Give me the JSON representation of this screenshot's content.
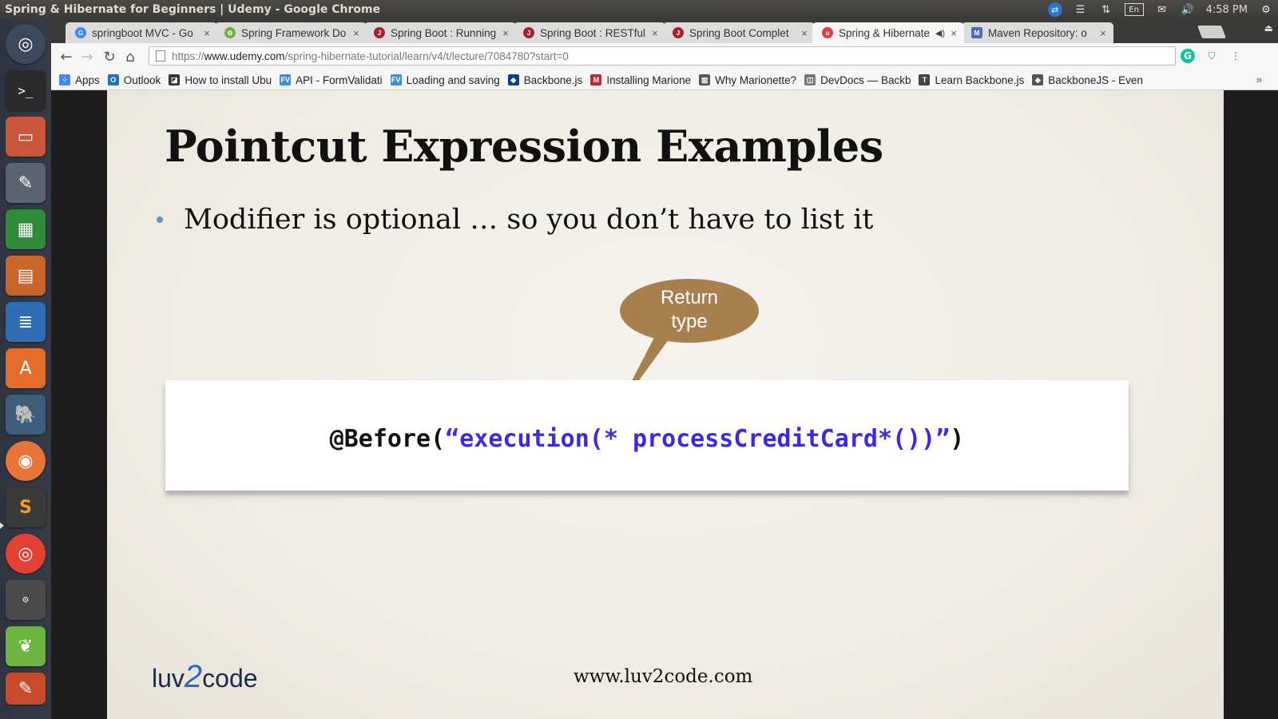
{
  "window_title": "Spring & Hibernate for Beginners | Udemy - Google Chrome",
  "system_tray": {
    "keyboard_layout": "En",
    "time": "4:58 PM"
  },
  "tabs": [
    {
      "label": "springboot MVC - Go",
      "favicon": "google-icon",
      "color": "#4285f4",
      "active": false
    },
    {
      "label": "Spring Framework Do",
      "favicon": "spring-icon",
      "color": "#6db33f",
      "active": false
    },
    {
      "label": "Spring Boot : Running",
      "favicon": "java-icon",
      "color": "#a3242c",
      "active": false
    },
    {
      "label": "Spring Boot : RESTful",
      "favicon": "java-icon",
      "color": "#a3242c",
      "active": false
    },
    {
      "label": "Spring Boot Complet",
      "favicon": "java-icon",
      "color": "#a3242c",
      "active": false
    },
    {
      "label": "Spring & Hibernate",
      "favicon": "udemy-icon",
      "color": "#e53a40",
      "active": true
    },
    {
      "label": "Maven Repository: o",
      "favicon": "maven-icon",
      "color": "#4a6fb5",
      "active": false
    }
  ],
  "address_bar": {
    "scheme": "https://",
    "host": "www.udemy.com",
    "path": "/spring-hibernate-tutorial/learn/v4/t/lecture/7084780?start=0"
  },
  "bookmarks": [
    {
      "label": "Apps",
      "icon": "apps-grid-icon",
      "color": "#4285f4"
    },
    {
      "label": "Outlook",
      "icon": "outlook-icon",
      "color": "#1f6fc5"
    },
    {
      "label": "How to install Ubu",
      "icon": "terminal-icon",
      "color": "#333"
    },
    {
      "label": "API - FormValidati",
      "icon": "fv-icon",
      "color": "#3a8ed8"
    },
    {
      "label": "Loading and saving",
      "icon": "fv-icon",
      "color": "#3a8ed8"
    },
    {
      "label": "Backbone.js",
      "icon": "backbone-icon",
      "color": "#0d3e8c"
    },
    {
      "label": "Installing Marione",
      "icon": "marionette-icon",
      "color": "#c0282d"
    },
    {
      "label": "Why Marionette?",
      "icon": "book-icon",
      "color": "#555"
    },
    {
      "label": "DevDocs — Backb",
      "icon": "devdocs-icon",
      "color": "#777"
    },
    {
      "label": "Learn Backbone.js",
      "icon": "text-icon",
      "color": "#444"
    },
    {
      "label": "BackboneJS - Even",
      "icon": "diamond-icon",
      "color": "#555"
    }
  ],
  "slide": {
    "title": "Pointcut Expression Examples",
    "bullet": "Modifier is optional … so you don’t have to list it",
    "callout_line1": "Return",
    "callout_line2": "type",
    "callout_color": "#a8804f",
    "code_prefix": "@Before(",
    "code_string": "“execution(* processCreditCard*())”",
    "code_suffix": ")",
    "logo_left": "luv",
    "logo_mid": "2",
    "logo_right": "code",
    "footer_url": "www.luv2code.com"
  }
}
